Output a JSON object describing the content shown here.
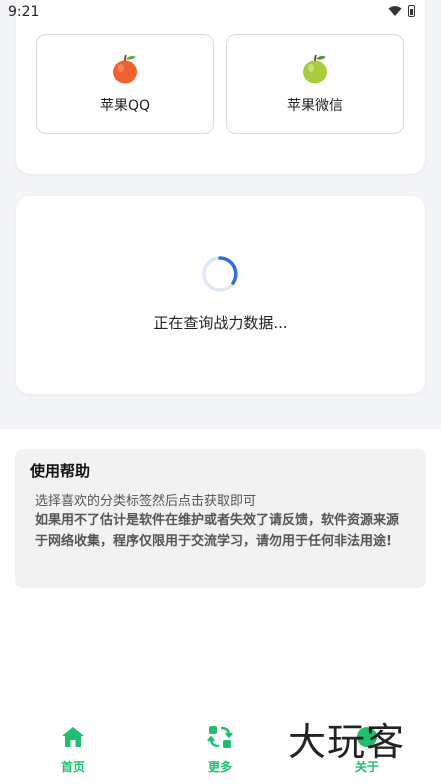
{
  "status_bar": {
    "time": "9:21"
  },
  "tiles": [
    {
      "label": "苹果QQ",
      "icon": "red-apple-icon"
    },
    {
      "label": "苹果微信",
      "icon": "green-apple-icon"
    }
  ],
  "loading": {
    "text": "正在查询战力数据..."
  },
  "help": {
    "title": "使用帮助",
    "line1": "选择喜欢的分类标签然后点击获取即可",
    "line2": "如果用不了估计是软件在维护或者失效了请反馈，软件资源来源于网络收集，程序仅限用于交流学习，请勿用于任何非法用途!"
  },
  "nav": {
    "home": "首页",
    "more": "更多",
    "about": "关于"
  },
  "watermark": "大玩客",
  "colors": {
    "accent": "#1fbf6f",
    "spinner": "#2f6fe0",
    "background": "#f4f5f9"
  }
}
